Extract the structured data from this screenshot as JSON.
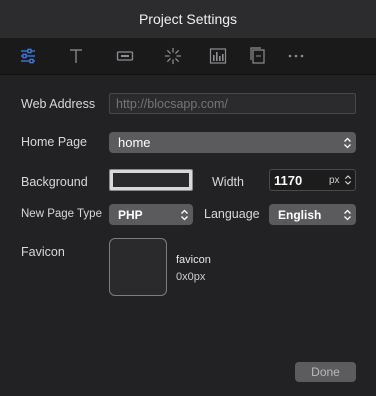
{
  "window": {
    "title": "Project Settings"
  },
  "toolbar": {
    "accent": "#3b7ff5",
    "icons": [
      "sliders-icon",
      "typography-icon",
      "button-icon",
      "loading-spinner-icon",
      "bar-chart-icon",
      "pages-icon",
      "more-icon"
    ]
  },
  "web_address": {
    "label": "Web Address",
    "placeholder": "http://blocsapp.com/"
  },
  "home_page": {
    "label": "Home Page",
    "value": "home"
  },
  "background": {
    "label": "Background",
    "color": "#2a2a2c"
  },
  "width": {
    "label": "Width",
    "value": "1170",
    "unit": "px"
  },
  "new_page_type": {
    "label": "New Page Type",
    "value": "PHP"
  },
  "language": {
    "label": "Language",
    "value": "English"
  },
  "favicon": {
    "label": "Favicon",
    "name": "favicon",
    "size": "0x0px"
  },
  "footer": {
    "done_label": "Done"
  }
}
